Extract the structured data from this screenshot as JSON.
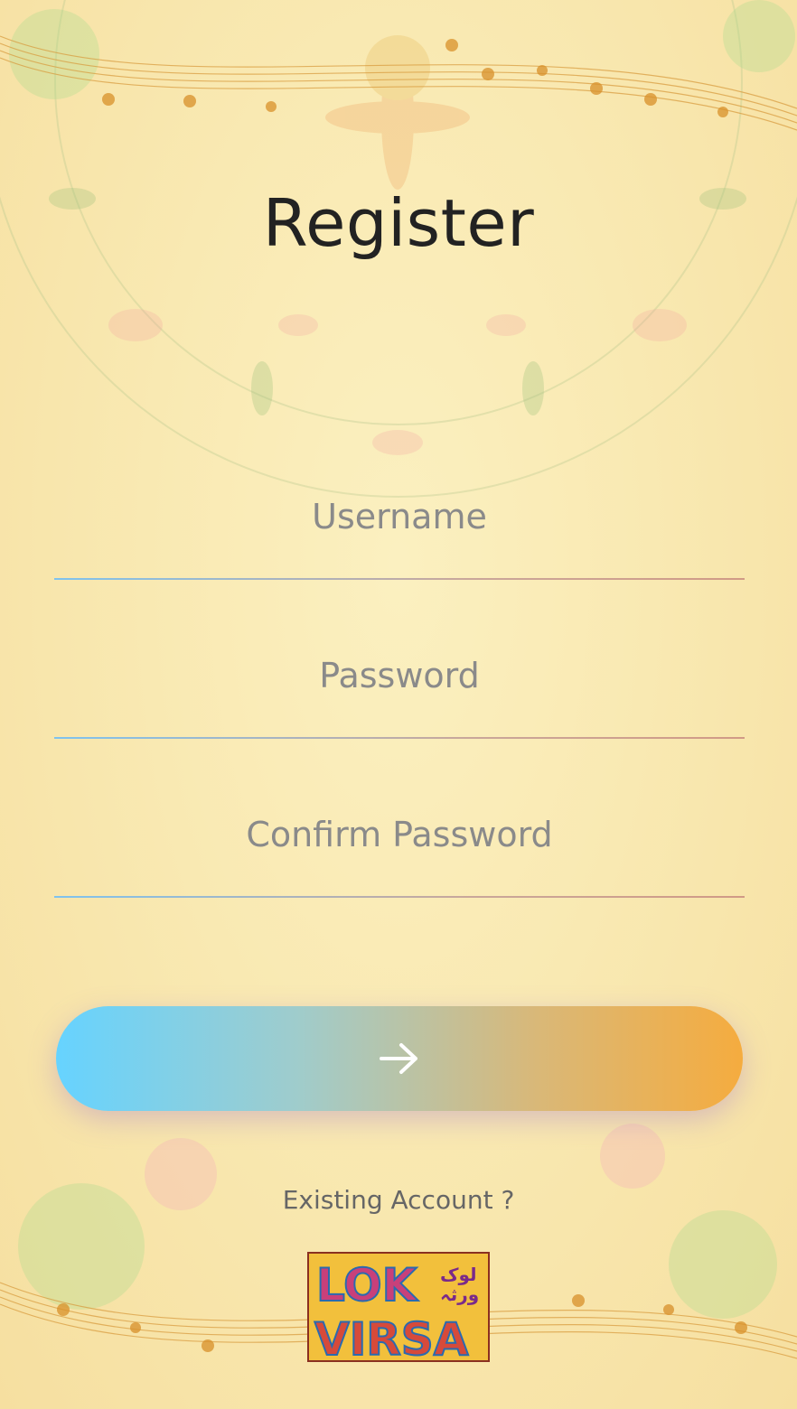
{
  "page": {
    "title": "Register"
  },
  "form": {
    "username_placeholder": "Username",
    "username_value": "",
    "password_placeholder": "Password",
    "password_value": "",
    "confirm_placeholder": "Confirm Password",
    "confirm_value": ""
  },
  "submit_button": {
    "icon": "arrow-right-icon"
  },
  "footer": {
    "existing_account_link": "Existing Account ?",
    "logo_text": "LOK VIRSA لوک ورثہ"
  },
  "colors": {
    "accent_start": "#66d3ff",
    "accent_end": "#f5ac3f",
    "background": "#f9e9b2"
  }
}
